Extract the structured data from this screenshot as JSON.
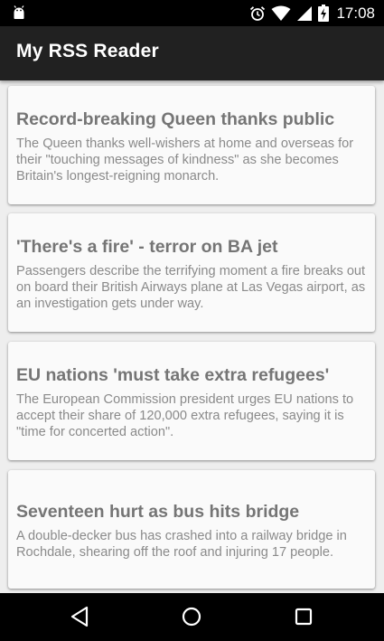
{
  "status_bar": {
    "time": "17:08",
    "icons": [
      "android-icon",
      "alarm-icon",
      "wifi-icon",
      "cell-signal-icon",
      "battery-charging-icon"
    ]
  },
  "app_bar": {
    "title": "My RSS Reader"
  },
  "feed": {
    "items": [
      {
        "title": "Record-breaking Queen thanks public",
        "description": "The Queen thanks well-wishers at home and overseas for their \"touching messages of kindness\" as she becomes Britain's longest-reigning monarch."
      },
      {
        "title": "'There's a fire' - terror on BA jet",
        "description": "Passengers describe the terrifying moment a fire breaks out on board their British Airways plane at Las Vegas airport, as an investigation gets under way."
      },
      {
        "title": "EU nations 'must take extra refugees'",
        "description": "The European Commission president urges EU nations to accept their share of 120,000 extra refugees, saying it is \"time for concerted action\"."
      },
      {
        "title": "Seventeen hurt as bus hits bridge",
        "description": "A double-decker bus has crashed into a railway bridge in Rochdale, shearing off the roof and injuring 17 people."
      }
    ]
  },
  "nav_bar": {
    "buttons": [
      "back-icon",
      "home-icon",
      "recents-icon"
    ]
  },
  "colors": {
    "status_bar": "#000000",
    "app_bar": "#212121",
    "background": "#eeeeee",
    "card": "#fafafa",
    "title_text": "#757575",
    "body_text": "#8a8a8a"
  }
}
